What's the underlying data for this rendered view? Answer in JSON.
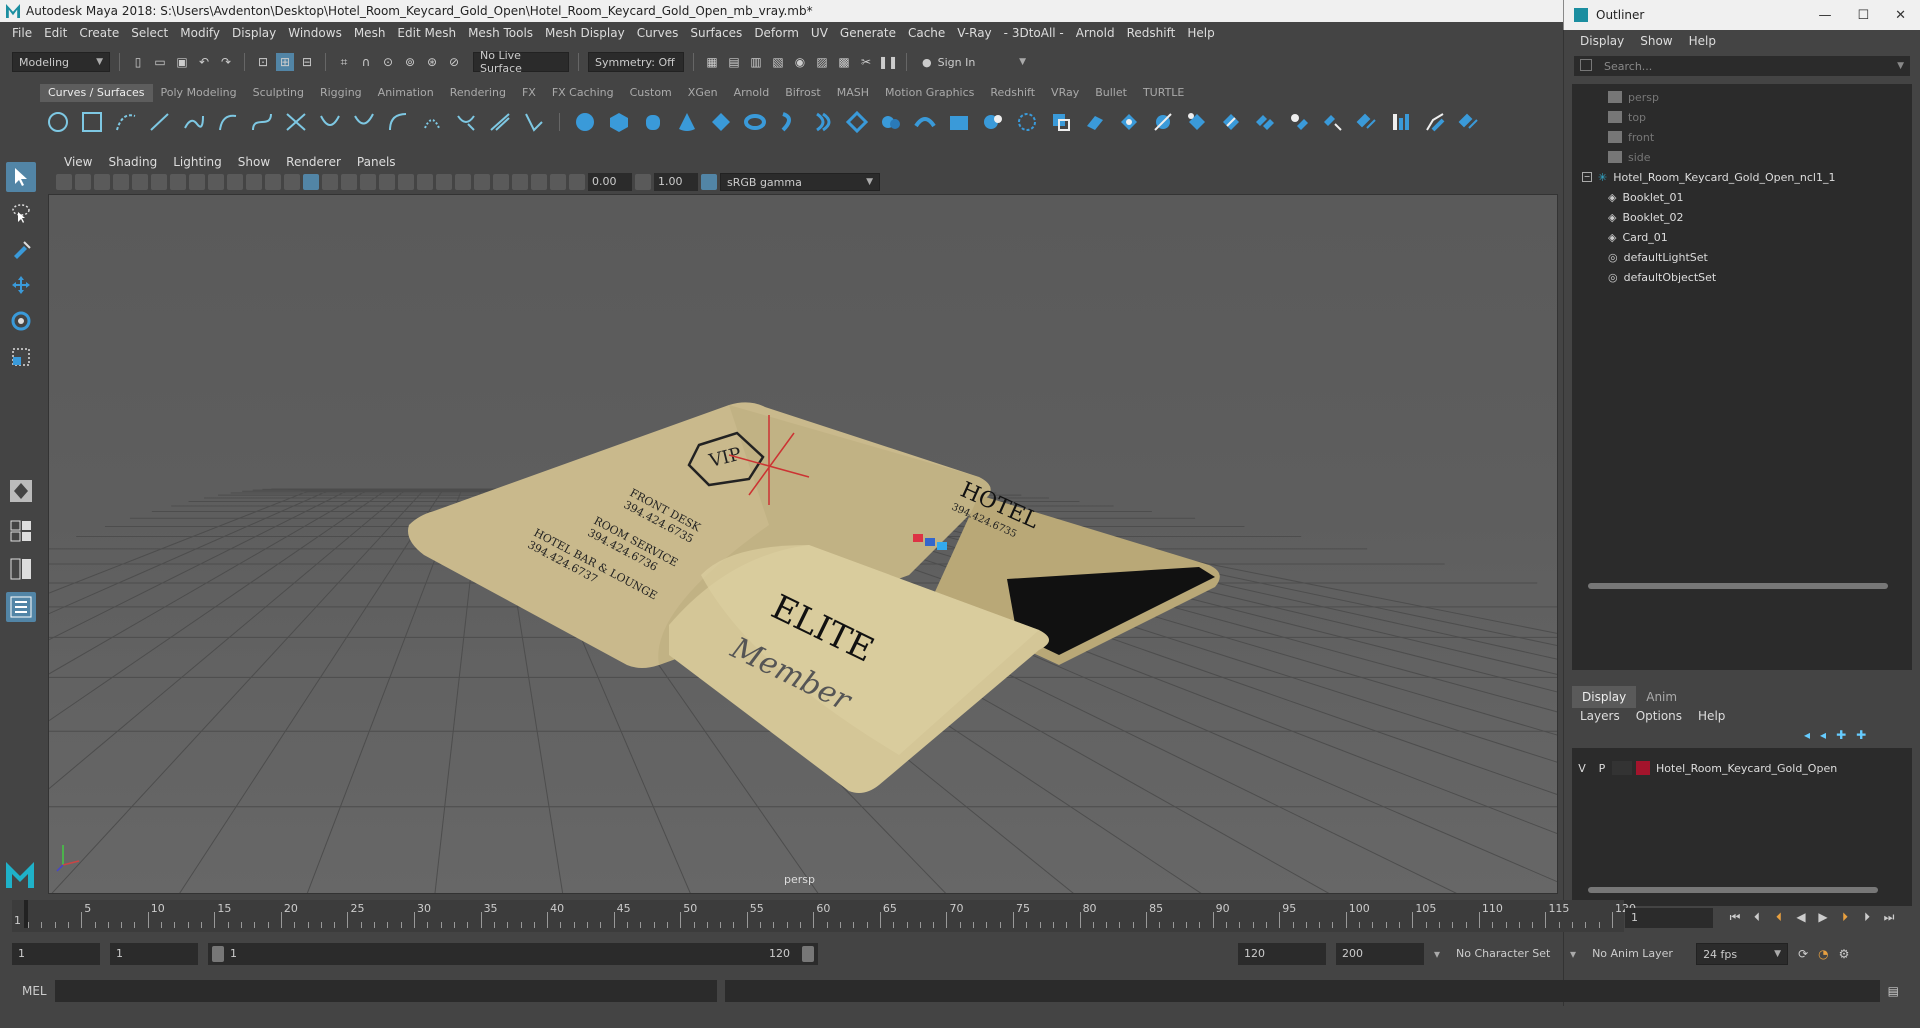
{
  "window": {
    "title": "Autodesk Maya 2018: S:\\Users\\Avdenton\\Desktop\\Hotel_Room_Keycard_Gold_Open\\Hotel_Room_Keycard_Gold_Open_mb_vray.mb*"
  },
  "menubar": [
    "File",
    "Edit",
    "Create",
    "Select",
    "Modify",
    "Display",
    "Windows",
    "Mesh",
    "Edit Mesh",
    "Mesh Tools",
    "Mesh Display",
    "Curves",
    "Surfaces",
    "Deform",
    "UV",
    "Generate",
    "Cache",
    "V-Ray",
    "- 3DtoAll -",
    "Arnold",
    "Redshift",
    "Help"
  ],
  "statusline": {
    "mode": "Modeling",
    "live_surface": "No Live Surface",
    "symmetry": "Symmetry: Off",
    "sign_in": "Sign In"
  },
  "shelf": {
    "tabs": [
      "Curves / Surfaces",
      "Poly Modeling",
      "Sculpting",
      "Rigging",
      "Animation",
      "Rendering",
      "FX",
      "FX Caching",
      "Custom",
      "XGen",
      "Arnold",
      "Bifrost",
      "MASH",
      "Motion Graphics",
      "Redshift",
      "VRay",
      "Bullet",
      "TURTLE"
    ],
    "active_tab": "Curves / Surfaces"
  },
  "viewport": {
    "menus": [
      "View",
      "Shading",
      "Lighting",
      "Show",
      "Renderer",
      "Panels"
    ],
    "near_value": "0.00",
    "far_value": "1.00",
    "color_space": "sRGB gamma",
    "camera_label": "persp",
    "card": {
      "vip_text": "VIP",
      "front_desk": "FRONT DESK",
      "front_desk_number": "394.424.6735",
      "room_service": "ROOM SERVICE",
      "room_service_number": "394.424.6736",
      "bar": "HOTEL BAR & LOUNGE",
      "bar_number": "394.424.6737",
      "hotel": "HOTEL",
      "hotel_number": "394.424.6735",
      "elite": "ELITE",
      "member": "Member"
    }
  },
  "outliner": {
    "title": "Outliner",
    "menus": [
      "Display",
      "Show",
      "Help"
    ],
    "search_placeholder": "Search...",
    "cameras": [
      "persp",
      "top",
      "front",
      "side"
    ],
    "group": "Hotel_Room_Keycard_Gold_Open_ncl1_1",
    "children": [
      "Booklet_01",
      "Booklet_02",
      "Card_01"
    ],
    "sets": [
      "defaultLightSet",
      "defaultObjectSet"
    ]
  },
  "layer_editor": {
    "tabs": [
      "Display",
      "Anim"
    ],
    "active_tab": "Display",
    "menus": [
      "Layers",
      "Options",
      "Help"
    ],
    "layer": {
      "visible": "V",
      "playback": "P",
      "name": "Hotel_Room_Keycard_Gold_Open",
      "color": "#a3142c"
    }
  },
  "timeline": {
    "ticks": [
      "5",
      "10",
      "15",
      "20",
      "25",
      "30",
      "35",
      "40",
      "45",
      "50",
      "55",
      "60",
      "65",
      "70",
      "75",
      "80",
      "85",
      "90",
      "95",
      "100",
      "105",
      "110",
      "115",
      "120"
    ],
    "start_tick": "1",
    "current_frame": "1"
  },
  "range": {
    "start": "1",
    "playback_start": "1",
    "range_start": "1",
    "range_end": "120",
    "playback_end": "120",
    "end": "200",
    "character_set": "No Character Set",
    "anim_layer": "No Anim Layer",
    "fps": "24 fps"
  },
  "command_line": {
    "label": "MEL"
  },
  "colors": {
    "accent": "#5285a6",
    "card_gold": "#c8b98a",
    "layer_red": "#a3142c"
  }
}
